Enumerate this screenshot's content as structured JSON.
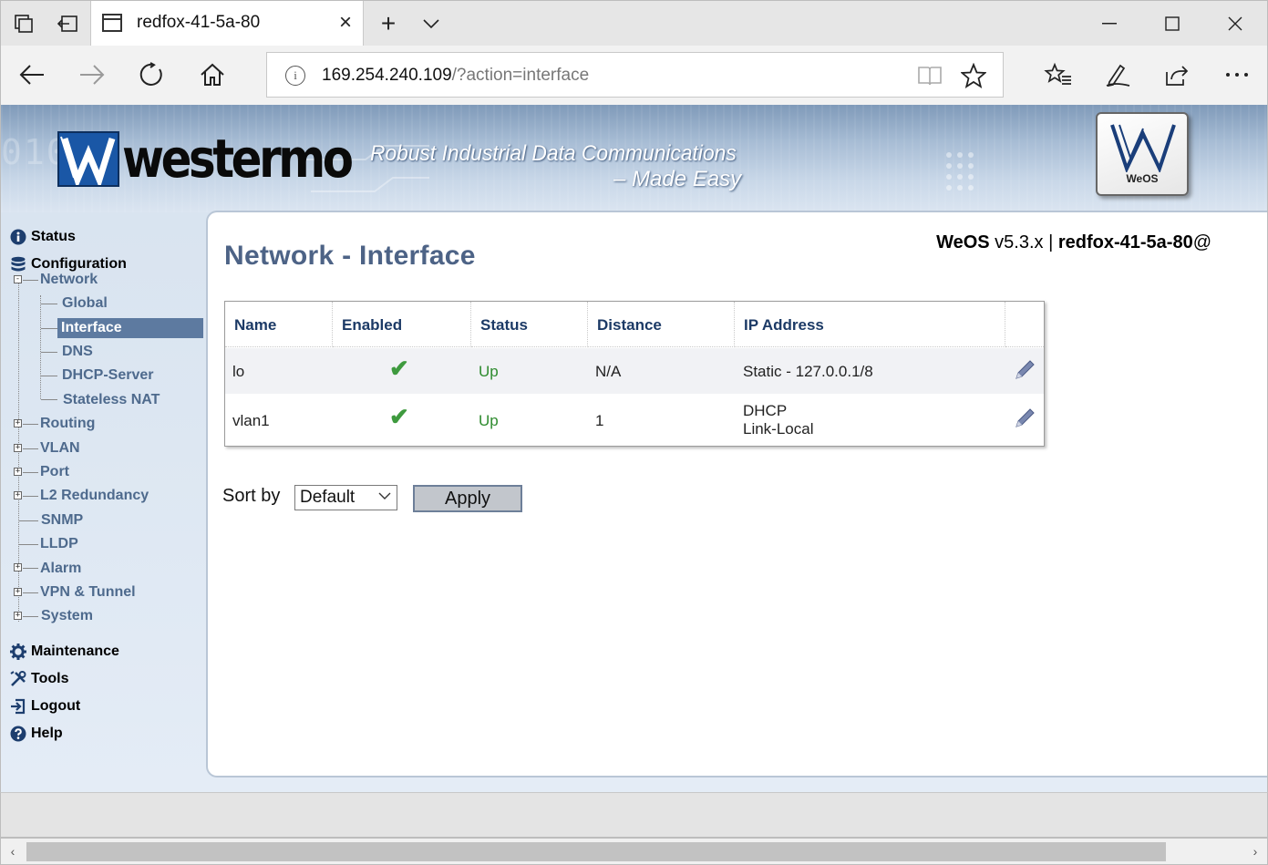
{
  "browser": {
    "tab_title": "redfox-41-5a-80",
    "url_host": "169.254.240.109",
    "url_path": "/?action=interface",
    "new_tab_symbol": "+",
    "close_tab_symbol": "×"
  },
  "banner": {
    "brand": "westermo",
    "slogan_line1": "Robust Industrial Data Communications",
    "slogan_line2": "– Made Easy",
    "badge_label": "WeOS",
    "binary_bg": "0101"
  },
  "sidebar": {
    "status": "Status",
    "configuration": "Configuration",
    "network": "Network",
    "network_children": [
      "Global",
      "Interface",
      "DNS",
      "DHCP-Server",
      "Stateless NAT"
    ],
    "config_items": [
      "Routing",
      "VLAN",
      "Port",
      "L2 Redundancy",
      "SNMP",
      "LLDP",
      "Alarm",
      "VPN & Tunnel",
      "System"
    ],
    "maintenance": "Maintenance",
    "tools": "Tools",
    "logout": "Logout",
    "help": "Help"
  },
  "header": {
    "title": "Network - Interface",
    "product": "WeOS",
    "version": " v5.3.x | ",
    "hostname": "redfox-41-5a-80",
    "at": "@"
  },
  "table": {
    "columns": [
      "Name",
      "Enabled",
      "Status",
      "Distance",
      "IP Address"
    ],
    "rows": [
      {
        "name": "lo",
        "enabled": "✔",
        "status": "Up",
        "distance": "N/A",
        "ip1": "Static - 127.0.0.1/8",
        "ip2": ""
      },
      {
        "name": "vlan1",
        "enabled": "✔",
        "status": "Up",
        "distance": "1",
        "ip1": "DHCP",
        "ip2": "Link-Local"
      }
    ]
  },
  "sort": {
    "label": "Sort by",
    "selected": "Default",
    "apply_label": "Apply"
  },
  "colors": {
    "title": "#4d6386",
    "table_header": "#1c3a66",
    "status_up": "#2e8b2e",
    "selected_bg": "#5d7aa0",
    "tree_text": "#4e6a8d"
  }
}
